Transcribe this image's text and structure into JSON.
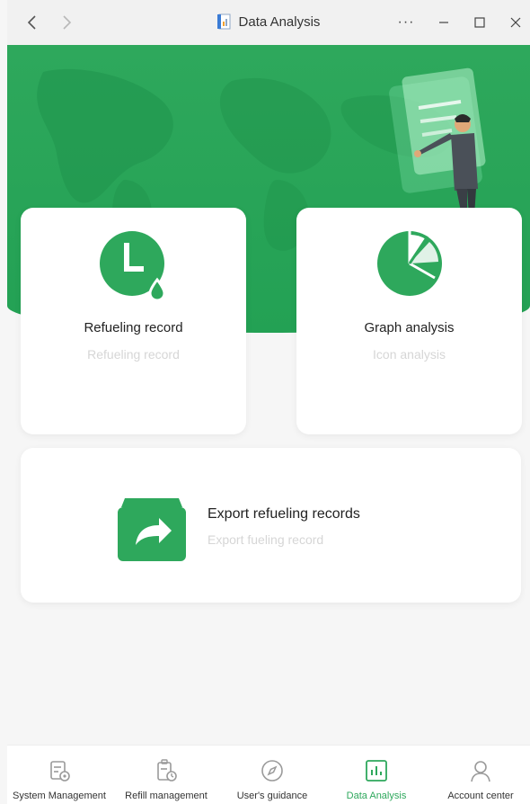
{
  "window": {
    "title": "Data Analysis",
    "more_label": "···"
  },
  "cards": [
    {
      "title": "Refueling record",
      "subtitle": "Refueling record"
    },
    {
      "title": "Graph analysis",
      "subtitle": "Icon analysis"
    }
  ],
  "export_card": {
    "title": "Export refueling records",
    "subtitle": "Export fueling record"
  },
  "bottom_nav": {
    "items": [
      {
        "label": "System Management",
        "icon": "system-management-icon",
        "active": false
      },
      {
        "label": "Refill management",
        "icon": "refill-management-icon",
        "active": false
      },
      {
        "label": "User's guidance",
        "icon": "compass-icon",
        "active": false
      },
      {
        "label": "Data Analysis",
        "icon": "bar-chart-icon",
        "active": true
      },
      {
        "label": "Account center",
        "icon": "user-icon",
        "active": false
      }
    ]
  },
  "colors": {
    "accent": "#2ea85c",
    "hero": "#23a154",
    "muted_text": "#d6d6d6"
  }
}
